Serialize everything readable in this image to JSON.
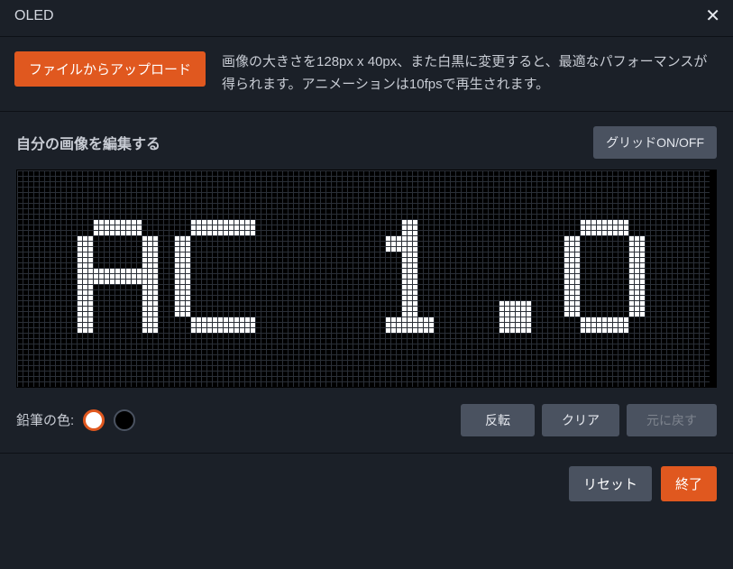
{
  "title": "OLED",
  "upload_button": "ファイルからアップロード",
  "help_text": "画像の大きさを128px x 40px、また白黒に変更すると、最適なパフォーマンスが得られます。アニメーションは10fpsで再生されます。",
  "editor_title": "自分の画像を編集する",
  "grid_toggle": "グリッドON/OFF",
  "pencil_label": "鉛筆の色:",
  "invert": "反転",
  "clear": "クリア",
  "undo": "元に戻す",
  "reset": "リセット",
  "done": "終了",
  "colors": {
    "accent": "#e0581f",
    "gray": "#4a5260"
  },
  "canvas": {
    "cols": 128,
    "rows": 40,
    "cell": 6,
    "text": "AC 1.0"
  }
}
